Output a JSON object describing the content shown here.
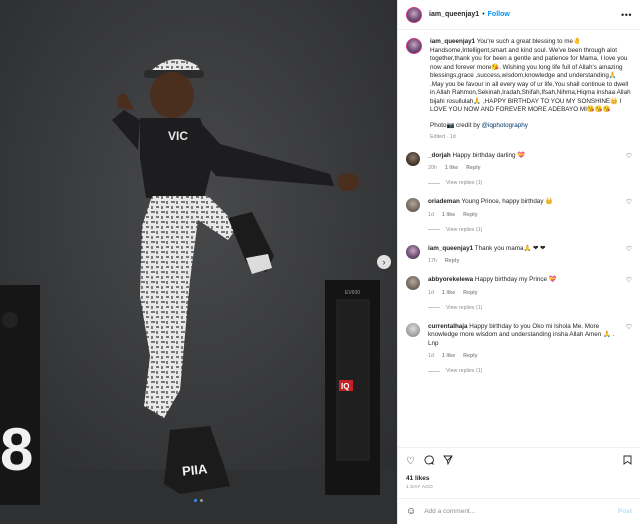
{
  "header": {
    "username": "iam_queenjay1",
    "separator": "•",
    "follow_label": "Follow",
    "more_icon": "more-horizontal-icon"
  },
  "caption": {
    "username": "iam_queenjay1",
    "text": "You're such a great blessing to me🤚 Handsome,Intelligent,smart and kind soul. We've been through alot together,thank you for been a gentle and patience for Mama, I love you now and forever more😘. Wishing you long life full of Allah's amazing blessings,grace ,success,wisdom,knowledge and understanding🙏 .May you be favour in all every way of ur life,You shall continue to dwell in Allah Rahmon,Sekinah,Iradah,Shifah,Ifsah,Nihma,Hiqma inshaa Allah bijahi rosullulah🙏 ,HAPPY BIRTHDAY TO YOU MY SONSHINE👑 I LOVE YOU NOW AND FOREVER MORE ADEBAYO MI😘😘😘",
    "photo_credit_prefix": "Photo📷 credit by",
    "photo_credit_handle": "@iqphotography",
    "edited": "Edited",
    "time": "1d"
  },
  "comments": [
    {
      "username": "_dorjah",
      "text": "Happy birthday darling 💝",
      "time": "20h",
      "likes": "1 like",
      "reply": "Reply",
      "view_replies": "View replies (1)"
    },
    {
      "username": "oriademan",
      "text": "Young Prince, happy birthday 👑",
      "time": "1d",
      "likes": "1 like",
      "reply": "Reply",
      "view_replies": "View replies (1)"
    },
    {
      "username": "iam_queenjay1",
      "text": "Thank you mama🙏 ❤ ❤",
      "time": "17h",
      "reply": "Reply"
    },
    {
      "username": "abbyorekelewa",
      "text": "Happy birthday my Prince 💝",
      "time": "1d",
      "likes": "1 like",
      "reply": "Reply",
      "view_replies": "View replies (1)"
    },
    {
      "username": "currentalhaja",
      "text": "Happy birthday to you Oko mi Ishola Me. More knowledge more wisdom and understanding insha Allah Amen 🙏 . Lnp",
      "time": "1d",
      "likes": "1 like",
      "reply": "Reply",
      "view_replies": "View replies (1)"
    }
  ],
  "actions": {
    "like_icon": "heart-icon",
    "comment_icon": "comment-icon",
    "share_icon": "share-icon",
    "save_icon": "bookmark-icon"
  },
  "likes_count": "41 likes",
  "posted_ago": "1 DAY AGO",
  "add_comment": {
    "placeholder": "Add a comment...",
    "post_label": "Post",
    "emoji_icon": "smiley-icon"
  },
  "photo": {
    "watermark": "IQ",
    "speaker_brand": "EV600",
    "carousel": {
      "count": 2,
      "active": 0
    },
    "next_icon": "chevron-right-icon"
  }
}
